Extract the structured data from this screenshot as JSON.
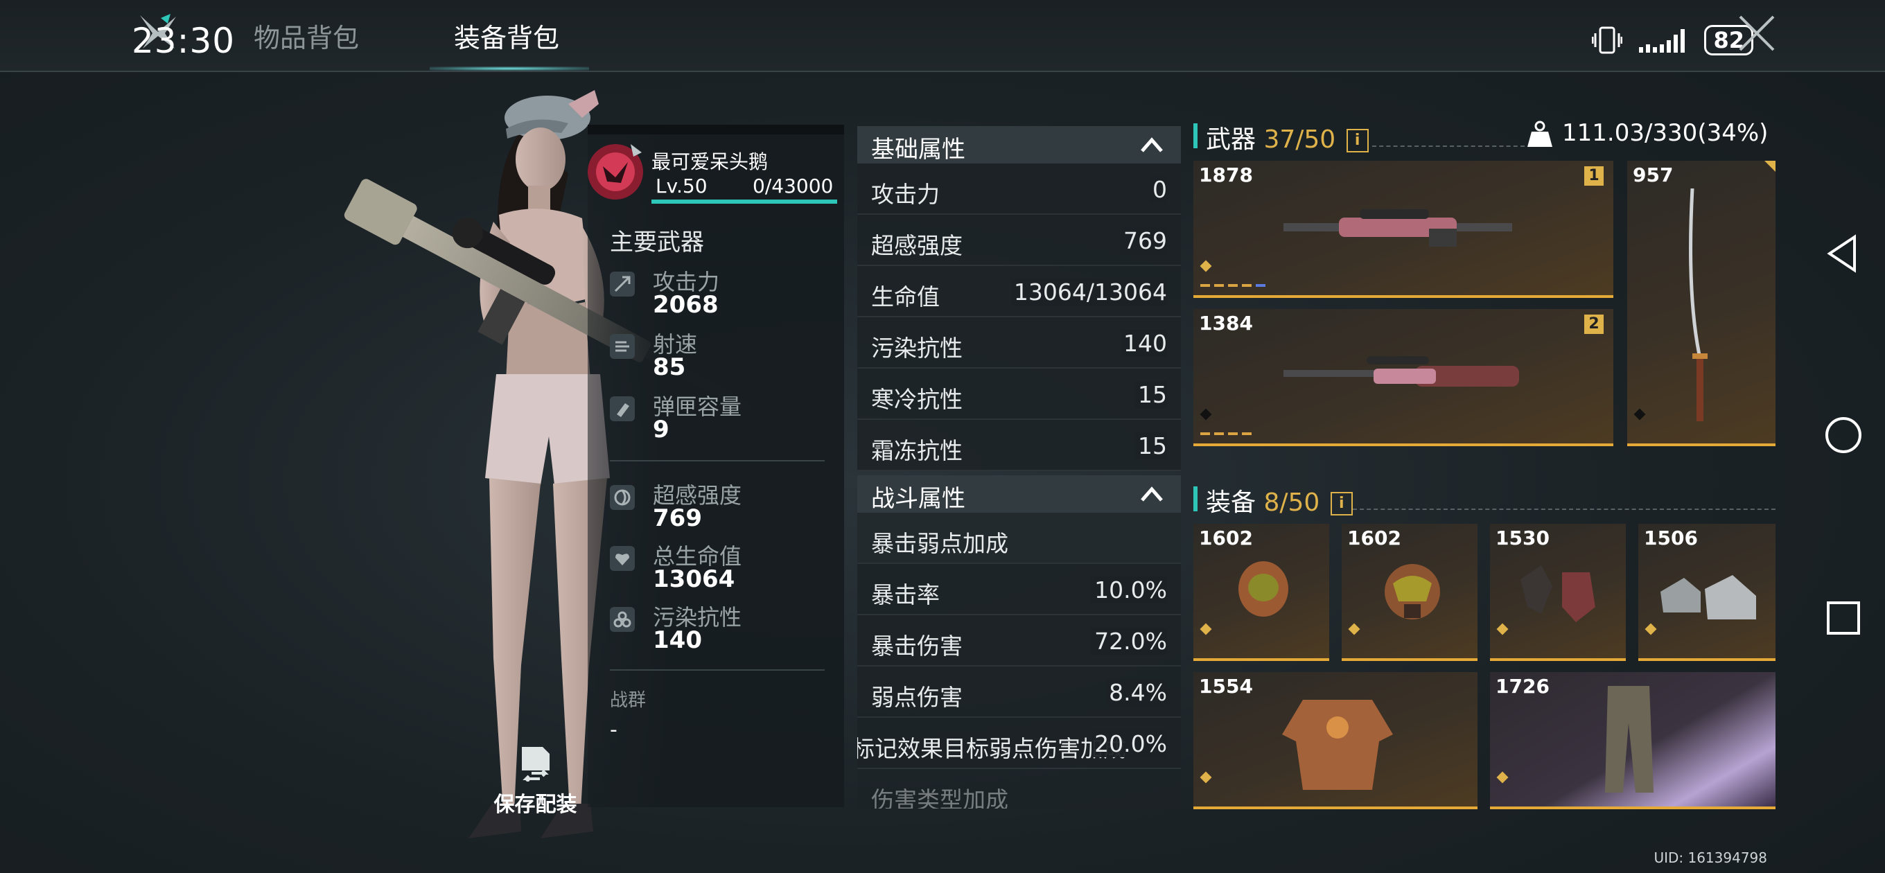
{
  "status_bar": {
    "time": "23:30",
    "battery": "82"
  },
  "tabs": [
    {
      "label": "物品背包",
      "active": false
    },
    {
      "label": "装备背包",
      "active": true
    }
  ],
  "player": {
    "name": "最可爱呆头鹅",
    "level": "Lv.50",
    "exp": "0/43000"
  },
  "main_weapon": {
    "title": "主要武器",
    "stats": [
      {
        "label": "攻击力",
        "value": "2068",
        "icon": "attack-icon"
      },
      {
        "label": "射速",
        "value": "85",
        "icon": "fire-rate-icon"
      },
      {
        "label": "弹匣容量",
        "value": "9",
        "icon": "magazine-icon"
      }
    ]
  },
  "char_stats": [
    {
      "label": "超感强度",
      "value": "769",
      "icon": "psi-icon"
    },
    {
      "label": "总生命值",
      "value": "13064",
      "icon": "health-icon"
    },
    {
      "label": "污染抗性",
      "value": "140",
      "icon": "biohazard-icon"
    }
  ],
  "clan": {
    "label": "战群",
    "value": "-"
  },
  "save_loadout": {
    "label": "保存配装"
  },
  "base_attributes": {
    "title": "基础属性",
    "rows": [
      {
        "label": "攻击力",
        "value": "0"
      },
      {
        "label": "超感强度",
        "value": "769"
      },
      {
        "label": "生命值",
        "value": "13064/13064"
      },
      {
        "label": "污染抗性",
        "value": "140"
      },
      {
        "label": "寒冷抗性",
        "value": "15"
      },
      {
        "label": "霜冻抗性",
        "value": "15"
      }
    ]
  },
  "combat_attributes": {
    "title": "战斗属性",
    "subheader": "暴击弱点加成",
    "rows": [
      {
        "label": "暴击率",
        "value": "10.0%"
      },
      {
        "label": "暴击伤害",
        "value": "72.0%"
      },
      {
        "label": "弱点伤害",
        "value": "8.4%"
      },
      {
        "label": "标记效果目标弱点伤害加成",
        "value": "20.0%"
      },
      {
        "label": "伤害类型加成",
        "value": ""
      }
    ]
  },
  "weapons": {
    "title": "武器",
    "count": "37/50",
    "weight": "111.03/330(34%)",
    "items": [
      {
        "power": "1878",
        "slot": "1",
        "type": "sniper-rifle"
      },
      {
        "power": "1384",
        "slot": "2",
        "type": "bolt-rifle"
      },
      {
        "power": "957",
        "slot": "",
        "type": "katana"
      }
    ]
  },
  "equipment": {
    "title": "装备",
    "count": "8/50",
    "items": [
      {
        "power": "1602",
        "type": "helmet"
      },
      {
        "power": "1602",
        "type": "gas-mask"
      },
      {
        "power": "1530",
        "type": "gloves"
      },
      {
        "power": "1506",
        "type": "shoes"
      },
      {
        "power": "1554",
        "type": "armor"
      },
      {
        "power": "1726",
        "type": "pants"
      }
    ]
  },
  "uid": "UID: 161394798",
  "colors": {
    "accent": "#2ec6b8",
    "gold": "#e0b24a",
    "panel": "#323b40"
  }
}
